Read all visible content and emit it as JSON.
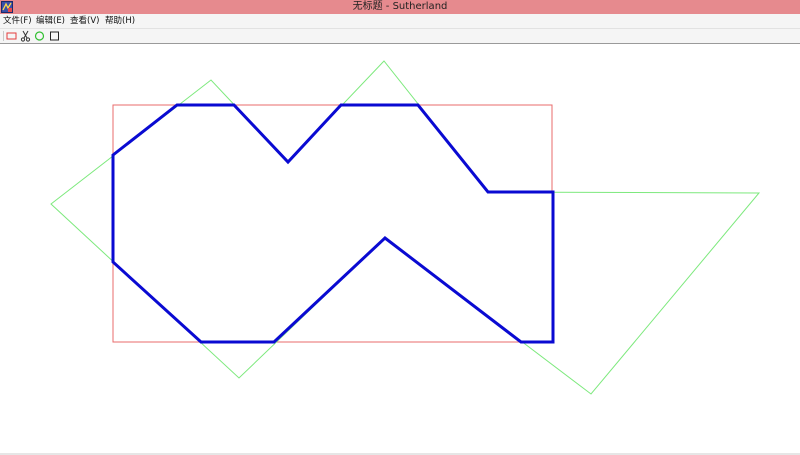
{
  "window": {
    "title": "无标题 - Sutherland"
  },
  "menu": {
    "items": [
      {
        "label": "文件(F)"
      },
      {
        "label": "编辑(E)"
      },
      {
        "label": "查看(V)"
      },
      {
        "label": "帮助(H)"
      }
    ]
  },
  "toolbar": {
    "tools": [
      "rectangle-tool",
      "scissors-tool",
      "circle-tool",
      "square-tool"
    ]
  },
  "colors": {
    "titlebar": "#e68a8e",
    "clip_window": "#e86b6b",
    "subject_polygon": "#7de97d",
    "clipped_polygon": "#0a0ad2"
  }
}
